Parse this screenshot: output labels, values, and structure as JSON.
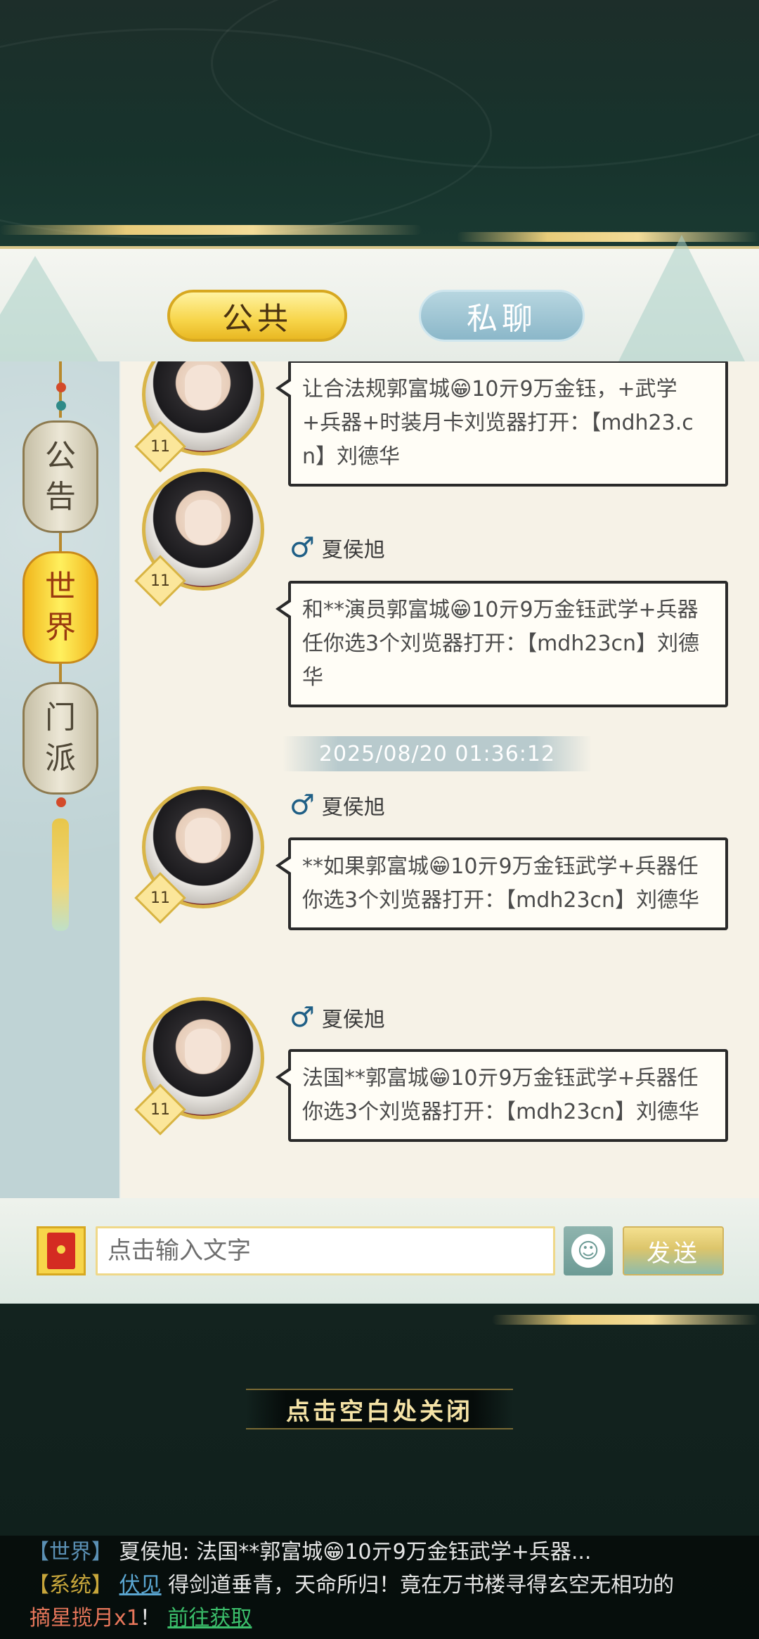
{
  "tabs": {
    "public": "公共",
    "private": "私聊"
  },
  "channels": [
    {
      "label_top": "公",
      "label_bottom": "告"
    },
    {
      "label_top": "世",
      "label_bottom": "界"
    },
    {
      "label_top": "门",
      "label_bottom": "派"
    }
  ],
  "messages": [
    {
      "level": "11",
      "sender": "",
      "text": "让合法规郭富城😁10亓9万金钰，+武学+兵器+时装月卡刘览器打开：【mdh23.cn】刘德华"
    },
    {
      "level": "11",
      "sender": "夏侯旭",
      "text": "和**演员郭富城😁10亓9万金钰武学+兵器任你选3个刘览器打开：【mdh23cn】刘德华"
    },
    {
      "level": "11",
      "sender": "夏侯旭",
      "text": "**如果郭富城😁10亓9万金钰武学+兵器任你选3个刘览器打开：【mdh23cn】刘德华"
    },
    {
      "level": "11",
      "sender": "夏侯旭",
      "text": "法国**郭富城😁10亓9万金钰武学+兵器任你选3个刘览器打开：【mdh23cn】刘德华"
    }
  ],
  "timestamp": "2025/08/20  01:36:12",
  "input": {
    "placeholder": "点击输入文字",
    "send_label": "发送"
  },
  "close_hint": "点击空白处关闭",
  "ticker": {
    "line1_tag": "【世界】",
    "line1_text": "夏侯旭: 法国**郭富城😁10亓9万金钰武学+兵器...",
    "line2_tag": "【系统】",
    "line2_link": "伏见",
    "line2_text": "得剑道垂青，天命所归！竟在万书楼寻得玄空无相功的",
    "line3_item": "摘星揽月x1",
    "line3_sep": "！",
    "line3_link": "前往获取"
  },
  "colors": {
    "gold": "#f7d54a",
    "teal": "#8fb4ae",
    "bubble_border": "#2a2a2a"
  },
  "icons": [
    "male-icon",
    "red-packet-icon",
    "emoji-icon",
    "level-badge-icon",
    "lantern-icon"
  ]
}
